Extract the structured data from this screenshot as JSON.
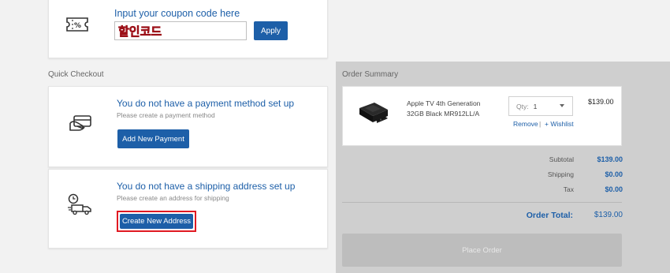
{
  "coupon": {
    "title": "Input your coupon code here",
    "input_value": "할인코드",
    "apply_label": "Apply"
  },
  "quick_checkout": {
    "label": "Quick Checkout",
    "payment": {
      "title": "You do not have a payment method set up",
      "subtitle": "Please create a payment method",
      "button_label": "Add New Payment"
    },
    "shipping": {
      "title": "You do not have a shipping address set up",
      "subtitle": "Please create an address for shipping",
      "button_label": "Create New Address"
    }
  },
  "order_summary": {
    "label": "Order Summary",
    "item": {
      "name_line1": "Apple TV 4th Generation",
      "name_line2": "32GB Black MR912LL/A",
      "qty_label": "Qty:",
      "qty_value": "1",
      "remove_label": "Remove",
      "separator": "|",
      "wishlist_label": "+ Wishlist",
      "price": "$139.00"
    },
    "totals": {
      "subtotal_label": "Subtotal",
      "subtotal_value": "$139.00",
      "shipping_label": "Shipping",
      "shipping_value": "$0.00",
      "tax_label": "Tax",
      "tax_value": "$0.00",
      "order_total_label": "Order Total:",
      "order_total_value": "$139.00"
    },
    "place_order_label": "Place Order"
  },
  "colors": {
    "accent": "#1d5fa8",
    "highlight": "#e01a22",
    "panel_gray": "#cfcfcf"
  },
  "icons": [
    "coupon-ticket-icon",
    "credit-card-hand-icon",
    "delivery-truck-clock-icon",
    "chevron-down-icon"
  ]
}
